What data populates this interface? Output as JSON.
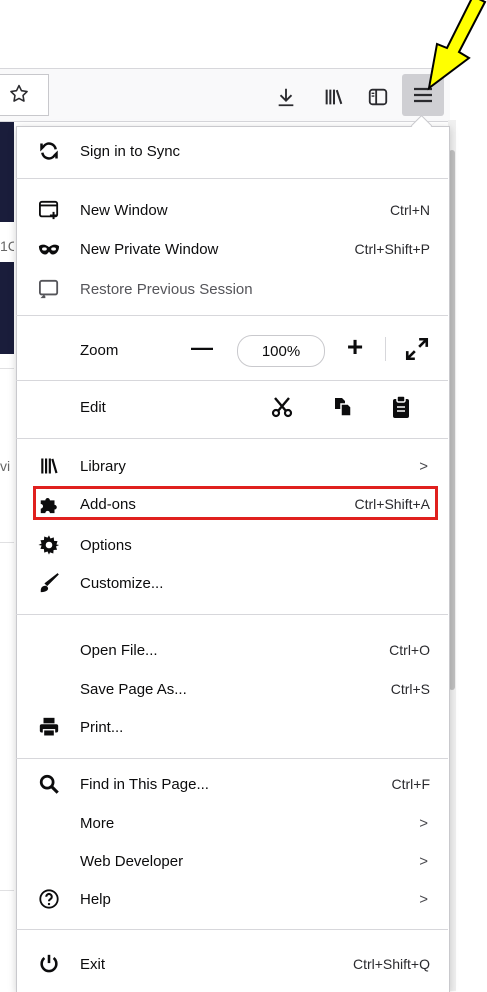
{
  "menu": {
    "sync": {
      "label": "Sign in to Sync"
    },
    "new_window": {
      "label": "New Window",
      "shortcut": "Ctrl+N"
    },
    "new_private": {
      "label": "New Private Window",
      "shortcut": "Ctrl+Shift+P"
    },
    "restore": {
      "label": "Restore Previous Session"
    },
    "zoom": {
      "label": "Zoom",
      "minus": "—",
      "level": "100%",
      "plus": "+"
    },
    "edit": {
      "label": "Edit"
    },
    "library": {
      "label": "Library",
      "chevron": ">"
    },
    "addons": {
      "label": "Add-ons",
      "shortcut": "Ctrl+Shift+A"
    },
    "options": {
      "label": "Options"
    },
    "customize": {
      "label": "Customize..."
    },
    "open_file": {
      "label": "Open File...",
      "shortcut": "Ctrl+O"
    },
    "save_page": {
      "label": "Save Page As...",
      "shortcut": "Ctrl+S"
    },
    "print": {
      "label": "Print..."
    },
    "find": {
      "label": "Find in This Page...",
      "shortcut": "Ctrl+F"
    },
    "more": {
      "label": "More",
      "chevron": ">"
    },
    "web_dev": {
      "label": "Web Developer",
      "chevron": ">"
    },
    "help": {
      "label": "Help",
      "chevron": ">"
    },
    "exit": {
      "label": "Exit",
      "shortcut": "Ctrl+Shift+Q"
    }
  },
  "background": {
    "text1": "1C",
    "text2": "vi"
  },
  "colors": {
    "highlight_border": "#e0201e",
    "arrow_fill": "#ffff00",
    "hamburger_active": "#cfcfd3"
  }
}
